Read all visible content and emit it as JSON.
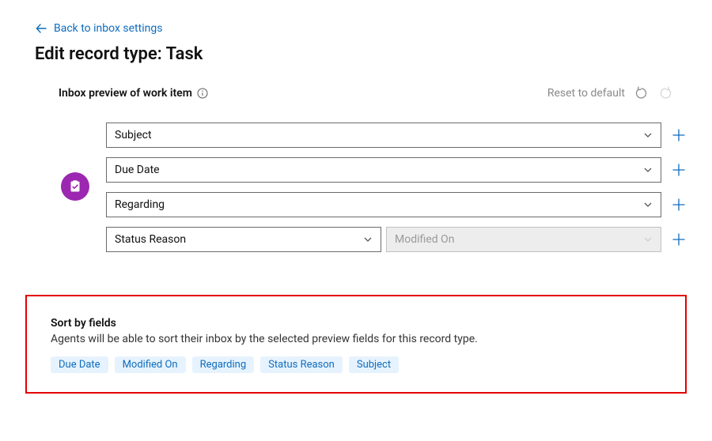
{
  "nav": {
    "back_label": "Back to inbox settings"
  },
  "page": {
    "title": "Edit record type: Task"
  },
  "preview": {
    "label": "Inbox preview of work item",
    "reset_label": "Reset to default"
  },
  "fields": {
    "row1": {
      "value": "Subject"
    },
    "row2": {
      "value": "Due Date"
    },
    "row3": {
      "value": "Regarding"
    },
    "row4_left": {
      "value": "Status Reason"
    },
    "row4_right": {
      "value": "Modified On"
    }
  },
  "sort": {
    "title": "Sort by fields",
    "desc": "Agents will be able to sort their inbox by the selected preview fields for this record type.",
    "chips": [
      "Due Date",
      "Modified On",
      "Regarding",
      "Status Reason",
      "Subject"
    ]
  }
}
